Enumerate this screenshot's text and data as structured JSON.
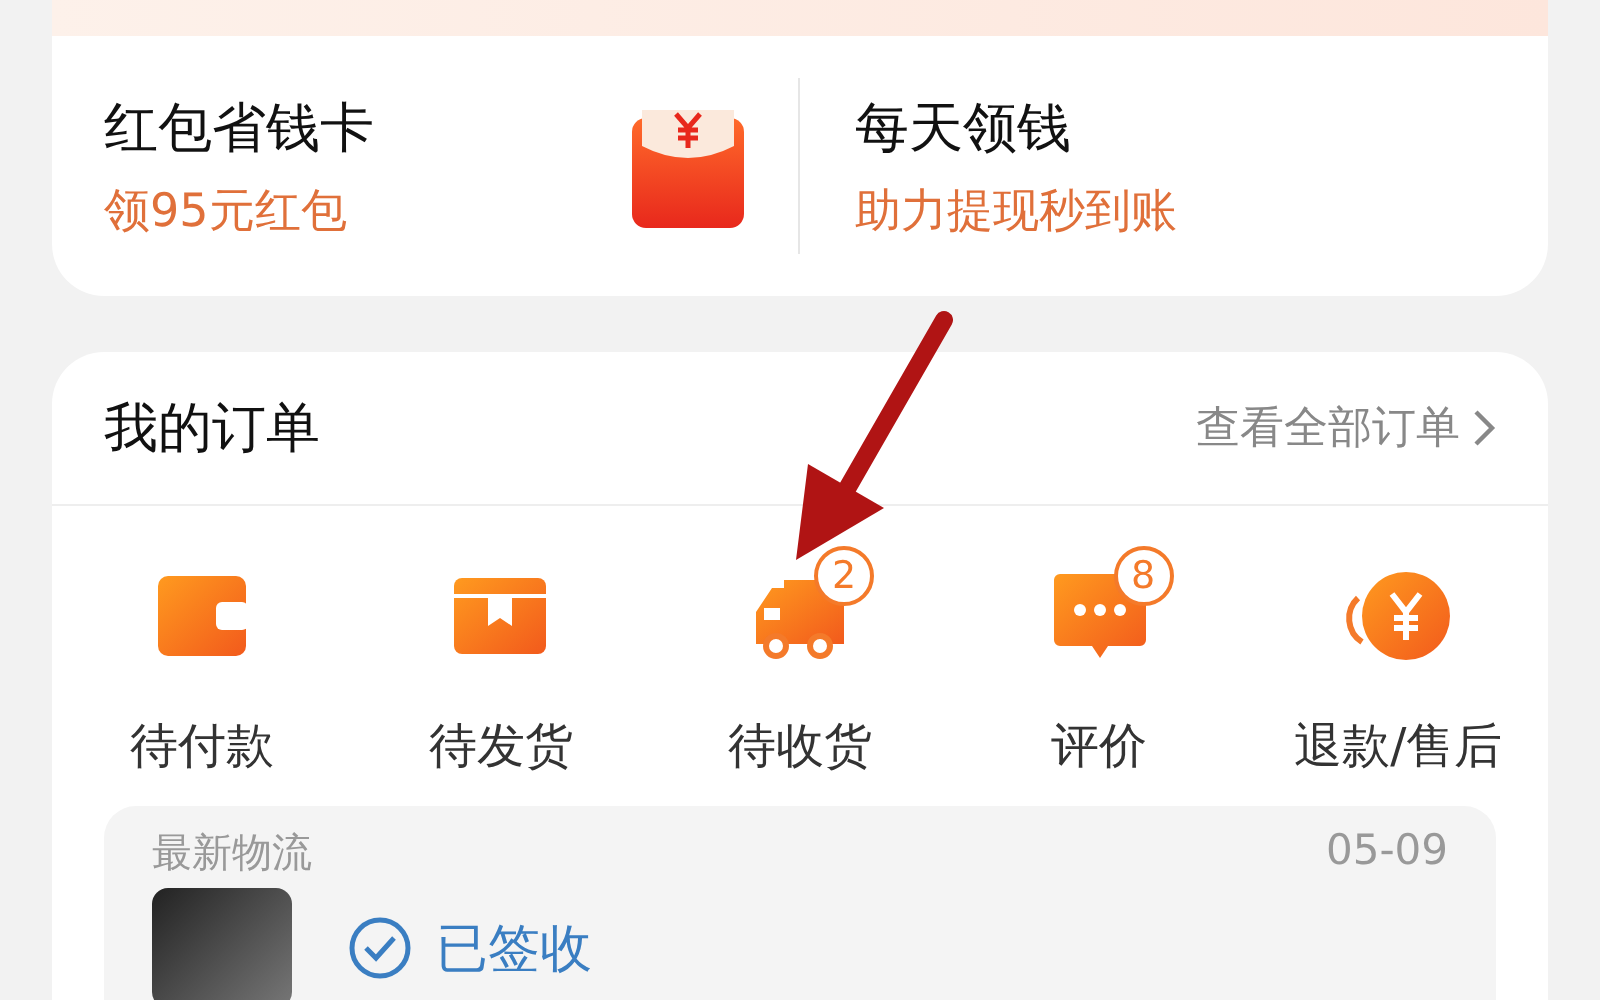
{
  "promo": [
    {
      "title": "红包省钱卡",
      "subtitle": "领95元红包",
      "kind": "envelope"
    },
    {
      "title": "每天领钱",
      "subtitle": "助力提现秒到账",
      "kind": "none"
    }
  ],
  "orders": {
    "title": "我的订单",
    "link": "查看全部订单",
    "items": [
      {
        "label": "待付款",
        "kind": "wallet"
      },
      {
        "label": "待发货",
        "kind": "box"
      },
      {
        "label": "待收货",
        "kind": "truck",
        "badge": "2"
      },
      {
        "label": "评价",
        "kind": "chat",
        "badge": "8"
      },
      {
        "label": "退款/售后",
        "kind": "refund"
      }
    ]
  },
  "logistics": {
    "title": "最新物流",
    "date": "05-09",
    "status": "已签收"
  }
}
